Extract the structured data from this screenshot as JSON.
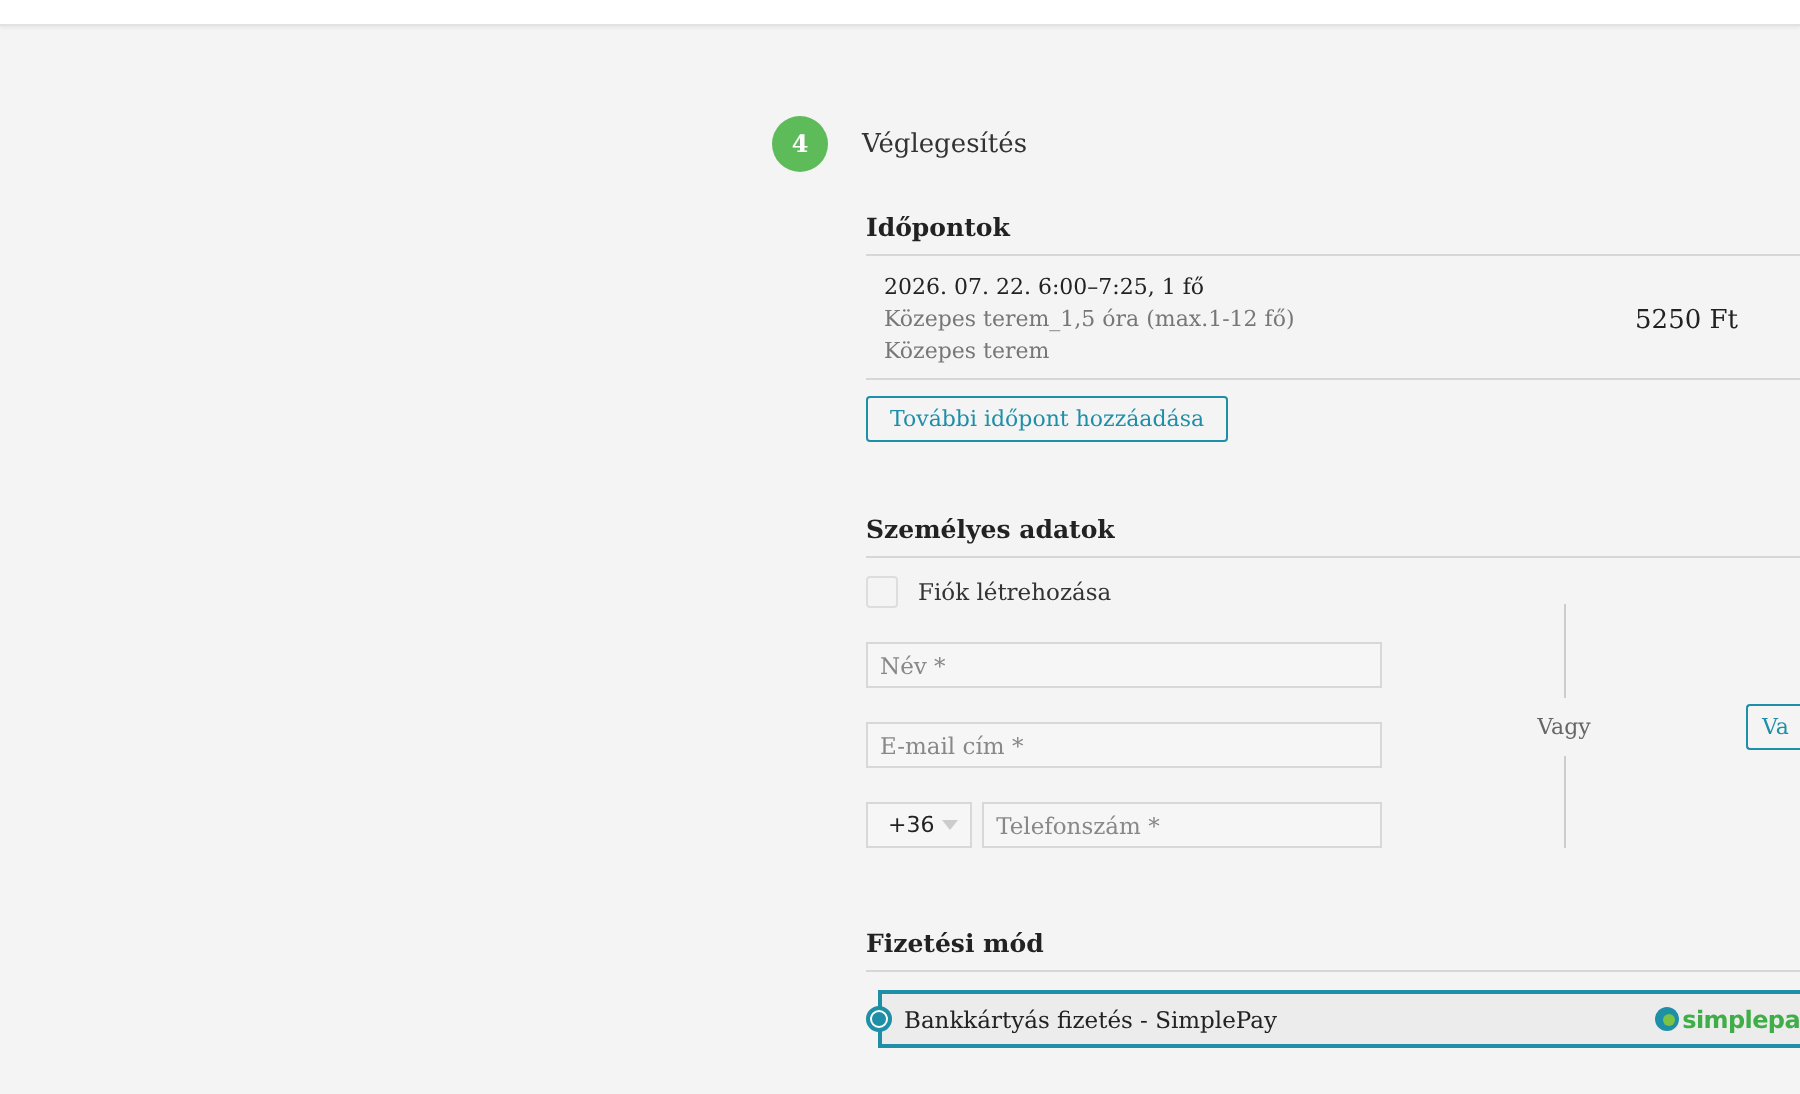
{
  "step": {
    "number": "4",
    "title": "Véglegesítés"
  },
  "appointments": {
    "heading": "Időpontok",
    "items": [
      {
        "title": "2026. 07. 22. 6:00–7:25, 1 fő",
        "details": [
          "Közepes terem_1,5 óra (max.1-12 fő)",
          "Közepes terem"
        ],
        "price": "5250 Ft"
      }
    ],
    "add_button": "További időpont hozzáadása"
  },
  "personal": {
    "heading": "Személyes adatok",
    "create_account": {
      "label": "Fiók létrehozása",
      "checked": false
    },
    "name_field": {
      "placeholder": "Név *"
    },
    "email_field": {
      "placeholder": "E-mail cím *"
    },
    "phone_code": {
      "value": "+36"
    },
    "phone_field": {
      "placeholder": "Telefonszám *"
    },
    "separator": "Vagy",
    "alt_button": "Va"
  },
  "payment": {
    "heading": "Fizetési mód",
    "options": [
      {
        "label": "Bankkártyás fizetés - SimplePay",
        "selected": true,
        "logo_text": "simplepa"
      }
    ]
  }
}
